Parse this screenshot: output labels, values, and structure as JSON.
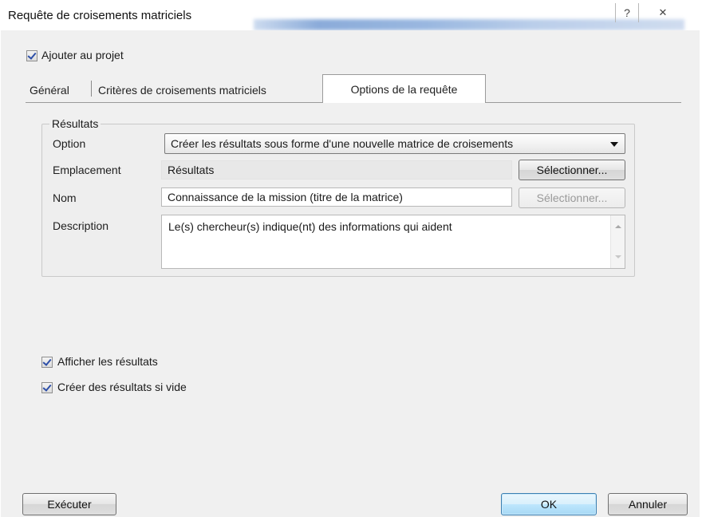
{
  "window": {
    "title": "Requête de croisements matriciels",
    "help_glyph": "?",
    "close_glyph": "✕"
  },
  "add_to_project": {
    "label": "Ajouter au projet",
    "checked": true
  },
  "tabs": [
    {
      "label": "Général",
      "active": false
    },
    {
      "label": "Critères de croisements matriciels",
      "active": false
    },
    {
      "label": "Options de la requête",
      "active": true
    }
  ],
  "results_group": {
    "title": "Résultats",
    "option": {
      "label": "Option",
      "selected": "Créer les résultats sous forme d'une nouvelle matrice de croisements"
    },
    "location": {
      "label": "Emplacement",
      "value": "Résultats",
      "button": "Sélectionner..."
    },
    "name": {
      "label": "Nom",
      "value": "Connaissance de la mission (titre de la matrice)",
      "button": "Sélectionner..."
    },
    "description": {
      "label": "Description",
      "value": "Le(s) chercheur(s) indique(nt) des informations qui aident"
    }
  },
  "show_results": {
    "label": "Afficher les résultats",
    "checked": true
  },
  "create_if_empty": {
    "label": "Créer des résultats si vide",
    "checked": true
  },
  "footer": {
    "execute": "Exécuter",
    "ok": "OK",
    "cancel": "Annuler"
  }
}
